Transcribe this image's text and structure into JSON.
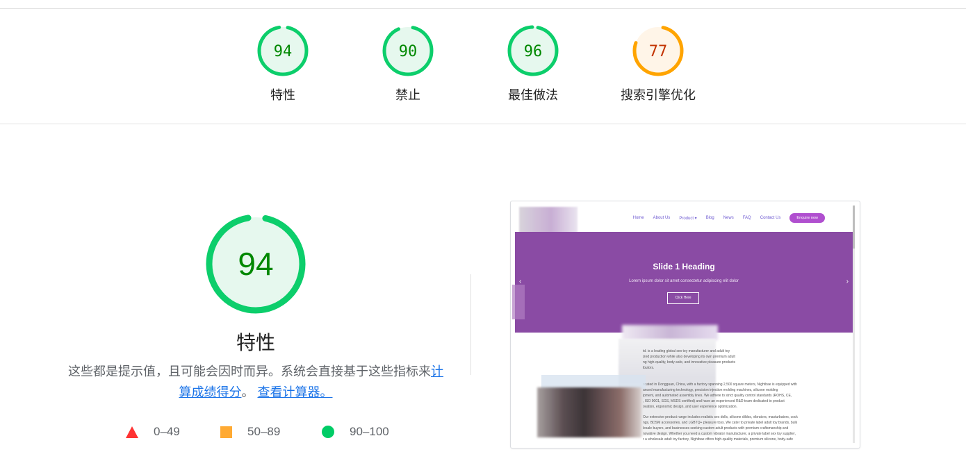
{
  "colors": {
    "pass": "#0cce6b",
    "pass_fill": "#e6f8ee",
    "pass_text": "#008800",
    "average": "#ffa400",
    "average_fill": "#fff5e8",
    "average_text": "#c33300",
    "fail": "#ff3333"
  },
  "summary": [
    {
      "score": 94,
      "label": "特性",
      "rating": "pass"
    },
    {
      "score": 90,
      "label": "禁止",
      "rating": "pass"
    },
    {
      "score": 96,
      "label": "最佳做法",
      "rating": "pass"
    },
    {
      "score": 77,
      "label": "搜索引擎优化",
      "rating": "average"
    }
  ],
  "main": {
    "score": 94,
    "title": "特性",
    "description": "这些都是提示值，且可能会因时而异。系统会直接基于这些指标来",
    "link_calc": "计算成绩得分",
    "sep": "。",
    "link_calculator": "查看计算器。"
  },
  "legend": [
    {
      "range": "0–49",
      "icon": "triangle-icon"
    },
    {
      "range": "50–89",
      "icon": "square-icon"
    },
    {
      "range": "90–100",
      "icon": "circle-icon"
    }
  ],
  "screenshot": {
    "nav": [
      "Home",
      "About Us",
      "Product",
      "Blog",
      "News",
      "FAQ",
      "Contact Us"
    ],
    "product_caret": "▾",
    "enquire": "Enquire now",
    "hero_title": "Slide 1 Heading",
    "hero_sub": "Lorem ipsum dolor sit amet consectetur adipiscing elit dolor",
    "hero_button": "Click Here",
    "arrow_left": "‹",
    "arrow_right": "›",
    "paragraphs": [
      "td. is a leading global sex toy manufacturer and adult toy\nized production while also developing its own premium adult\nng high-quality, body-safe, and innovative pleasure products\nibutors.",
      "ocated in Dongguan, China, with a factory spanning 2,500 square meters, Nightbae is equipped with\nanced manufacturing technology, precision injection molding machines, silicone molding\nipment, and automated assembly lines. We adhere to strict quality control standards (ROHS, CE,\n, ISO 9001, SGS, MSDS certified) and have an experienced R&D team dedicated to product\novation, ergonomic design, and user experience optimization.",
      "Our extensive product range includes realistic sex dolls, silicone dildos, vibrators, masturbators, cock\nngs, BDSM accessories, and LGBTQ+ pleasure toys. We cater to private label adult toy brands, bulk\nlesale buyers, and businesses seeking custom adult products with premium craftsmanship and\nnovative design. Whether you need a custom vibrator manufacturer, a private label sex toy supplier,\nr a wholesale adult toy factory, Nightbae offers high-quality materials, premium silicone, body-safe"
    ]
  }
}
